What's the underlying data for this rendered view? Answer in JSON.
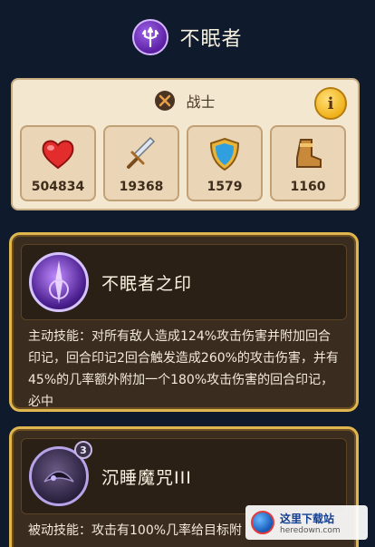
{
  "hero": {
    "name": "不眠者",
    "emblem_icon": "trident-icon",
    "emblem_color": "#6a2bbd"
  },
  "stats_panel": {
    "class_label": "战士",
    "class_icon": "crossed-swords-icon",
    "info_label": "i",
    "stats": [
      {
        "icon": "heart-icon",
        "value": "504834"
      },
      {
        "icon": "sword-icon",
        "value": "19368"
      },
      {
        "icon": "shield-icon",
        "value": "1579"
      },
      {
        "icon": "boot-icon",
        "value": "1160"
      }
    ]
  },
  "skills": [
    {
      "name": "不眠者之印",
      "icon": "purple-mark-icon",
      "level": "",
      "description": "主动技能：对所有敌人造成124%攻击伤害并附加回合印记，回合印记2回合触发造成260%的攻击伤害，并有45%的几率额外附加一个180%攻击伤害的回合印记，必中"
    },
    {
      "name": "沉睡魔咒III",
      "icon": "sleep-curse-icon",
      "level": "3",
      "description": "被动技能：攻击有100%几率给目标附"
    }
  ],
  "watermark": {
    "cn": "这里下载站",
    "en": "heredown.com"
  },
  "colors": {
    "background": "#0f1a2c",
    "card_border": "#e0b64e",
    "stats_bg": "#f3e7cf"
  }
}
